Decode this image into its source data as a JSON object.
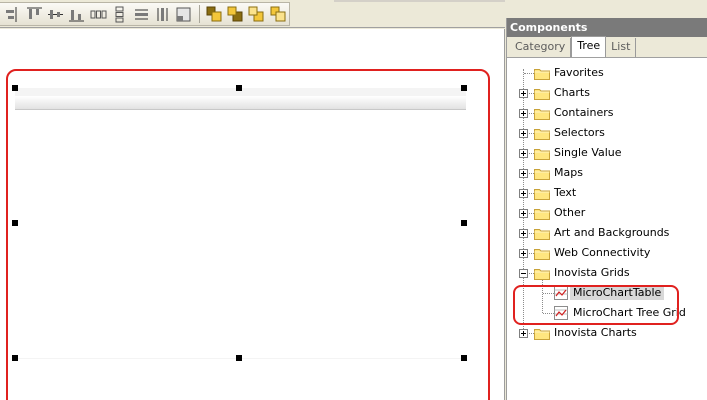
{
  "colors": {
    "selection_outline": "#e0211f",
    "panel_title_bg": "#7a7a7a",
    "folder_fill": "#ffe680",
    "folder_stroke": "#c8a23a"
  },
  "toolbar": {
    "buttons": [
      "align-right-icon",
      "align-top-icon",
      "align-middle-icon",
      "align-bottom-icon",
      "distribute-horizontal-icon",
      "distribute-vertical-icon",
      "same-width-icon",
      "same-height-icon",
      "same-size-icon",
      "bring-to-front-icon",
      "send-to-back-icon",
      "bring-forward-icon",
      "send-backward-icon"
    ]
  },
  "components_panel": {
    "title": "Components",
    "tabs": [
      {
        "label": "Category",
        "active": false
      },
      {
        "label": "Tree",
        "active": true
      },
      {
        "label": "List",
        "active": false
      }
    ],
    "tree": {
      "items": [
        {
          "label": "Favorites",
          "expander": "none",
          "icon": "folder-icon"
        },
        {
          "label": "Charts",
          "expander": "plus",
          "icon": "folder-icon"
        },
        {
          "label": "Containers",
          "expander": "plus",
          "icon": "folder-icon"
        },
        {
          "label": "Selectors",
          "expander": "plus",
          "icon": "folder-icon"
        },
        {
          "label": "Single Value",
          "expander": "plus",
          "icon": "folder-icon"
        },
        {
          "label": "Maps",
          "expander": "plus",
          "icon": "folder-icon"
        },
        {
          "label": "Text",
          "expander": "plus",
          "icon": "folder-icon"
        },
        {
          "label": "Other",
          "expander": "plus",
          "icon": "folder-icon"
        },
        {
          "label": "Art and Backgrounds",
          "expander": "plus",
          "icon": "folder-icon"
        },
        {
          "label": "Web Connectivity",
          "expander": "plus",
          "icon": "folder-icon"
        },
        {
          "label": "Inovista Grids",
          "expander": "minus",
          "icon": "folder-icon"
        },
        {
          "label": "MicroChartTable",
          "expander": "child",
          "icon": "microchart-icon",
          "selected": true
        },
        {
          "label": "MicroChart Tree Grid",
          "expander": "child",
          "icon": "microchart-icon"
        },
        {
          "label": "Inovista Charts",
          "expander": "plus",
          "icon": "folder-icon"
        }
      ]
    }
  }
}
